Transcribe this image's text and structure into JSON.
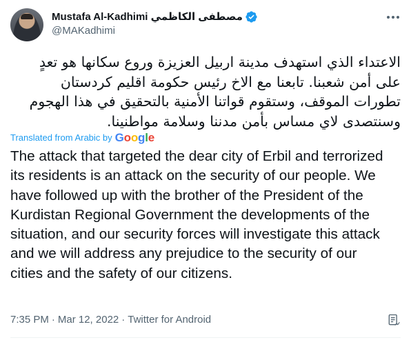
{
  "author": {
    "display_name": "Mustafa Al-Kadhimi مصطفى الكاظمي",
    "handle": "@MAKadhimi",
    "verified": true
  },
  "tweet": {
    "original_text": "الاعتداء الذي استهدف مدينة اربيل العزيزة وروع سكانها هو تعدٍ على أمن شعبنا. تابعنا مع الاخ رئيس حكومة اقليم كردستان تطورات الموقف، وستقوم قواتنا الأمنية بالتحقيق في هذا الهجوم وسنتصدى لاي مساس بأمن مدننا وسلامة مواطنينا.",
    "translated_label": "Translated from Arabic by",
    "translation_brand": "Google",
    "translated_text": "The attack that targeted the dear city of Erbil and terrorized its residents is an attack on the security of our people. We have followed up with the brother of the President of the Kurdistan Regional Government the developments of the situation, and our security forces will investigate this attack and we will address any prejudice to the security of our cities and the safety of our citizens."
  },
  "meta": {
    "time": "7:35 PM",
    "date": "Mar 12, 2022",
    "source": "Twitter for Android",
    "separator": "·"
  },
  "icons": {
    "verified": "verified-badge-icon",
    "more": "more-options-icon",
    "analytics": "tweet-analytics-icon"
  },
  "colors": {
    "accent": "#1d9bf0",
    "text": "#0f1419",
    "secondary": "#536471",
    "google_blue": "#4285F4",
    "google_red": "#EA4335",
    "google_yellow": "#FBBC05",
    "google_green": "#34A853"
  }
}
